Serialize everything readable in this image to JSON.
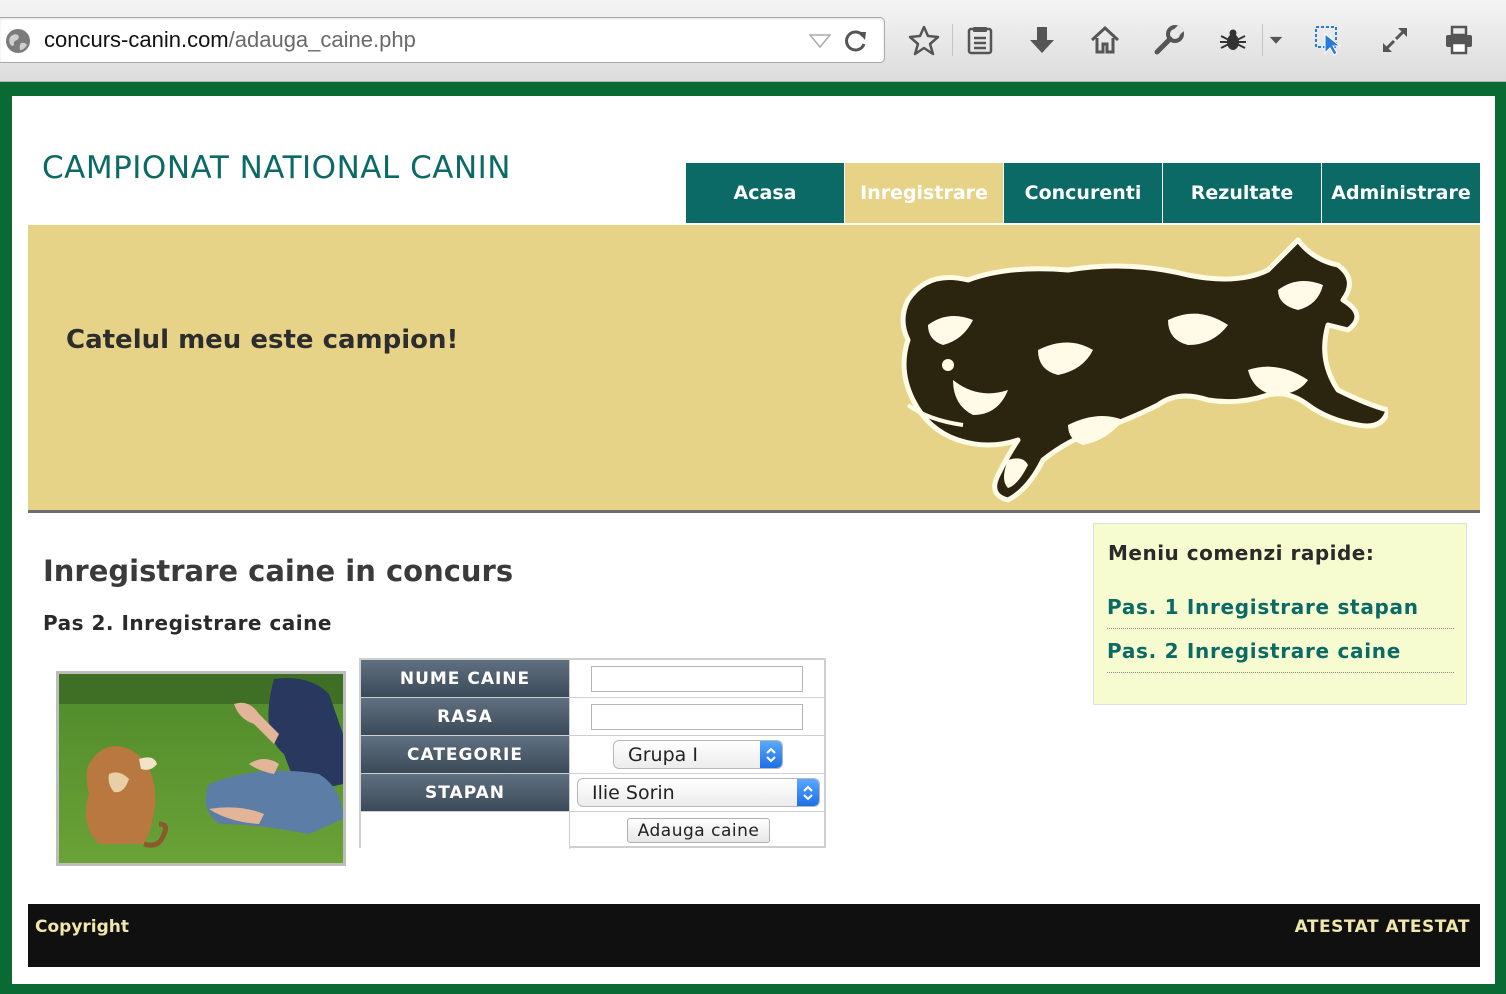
{
  "browser": {
    "url_domain": "concurs-canin.com",
    "url_path": "/adauga_caine.php",
    "toolbar_icons": [
      "star-icon",
      "reading-list-icon",
      "download-icon",
      "home-icon",
      "wrench-icon",
      "bug-icon",
      "dropdown-icon",
      "pointer-icon",
      "fullscreen-icon",
      "print-icon"
    ]
  },
  "header": {
    "site_title": "CAMPIONAT NATIONAL CANIN"
  },
  "nav": {
    "items": [
      {
        "label": "Acasa"
      },
      {
        "label": "Inregistrare"
      },
      {
        "label": "Concurenti"
      },
      {
        "label": "Rezultate"
      },
      {
        "label": "Administrare"
      }
    ],
    "active": "Inregistrare"
  },
  "banner": {
    "tagline": "Catelul meu este campion!"
  },
  "main": {
    "heading": "Inregistrare caine in concurs",
    "step_heading": "Pas 2. Inregistrare caine",
    "form": {
      "name_label": "NUME CAINE",
      "name_value": "",
      "breed_label": "RASA",
      "breed_value": "",
      "category_label": "CATEGORIE",
      "category_selected": "Grupa I",
      "owner_label": "STAPAN",
      "owner_selected": "Ilie Sorin",
      "submit_label": "Adauga caine"
    }
  },
  "sidebar": {
    "title": "Meniu comenzi rapide:",
    "links": [
      {
        "label": "Pas. 1 Inregistrare stapan"
      },
      {
        "label": "Pas. 2 Inregistrare caine"
      }
    ]
  },
  "footer": {
    "left": "Copyright",
    "right": "ATESTAT ATESTAT"
  },
  "colors": {
    "frame_green": "#0a6a33",
    "teal": "#0b6a66",
    "sand": "#e6d387",
    "sidebar_bg": "#f7fbd0",
    "footer_bg": "#101010",
    "footer_text": "#f0e8a8"
  }
}
